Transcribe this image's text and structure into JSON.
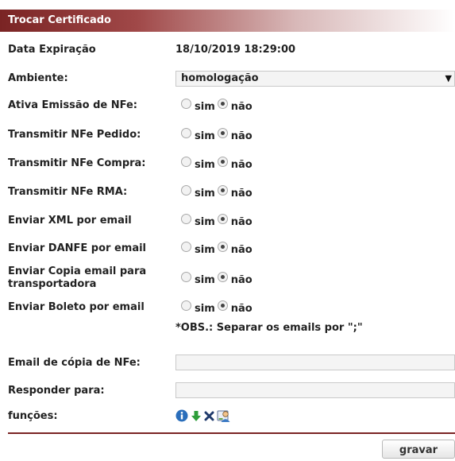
{
  "header": {
    "title": "Trocar Certificado"
  },
  "form": {
    "expiration": {
      "label": "Data Expiração",
      "value": "18/10/2019 18:29:00"
    },
    "ambiente": {
      "label": "Ambiente:",
      "selected": "homologação"
    },
    "radio_options": {
      "yes": "sim",
      "no": "não"
    },
    "settings": [
      {
        "label": "Ativa Emissão de NFe:",
        "value": "não"
      },
      {
        "label": "Transmitir NFe Pedido:",
        "value": "não"
      },
      {
        "label": "Transmitir NFe Compra:",
        "value": "não"
      },
      {
        "label": "Transmitir NFe RMA:",
        "value": "não"
      },
      {
        "label": "Enviar XML por email",
        "value": "não"
      },
      {
        "label": "Enviar DANFE por email",
        "value": "não"
      },
      {
        "label": "Enviar Copia email para transportadora",
        "value": "não"
      },
      {
        "label": "Enviar Boleto por email",
        "value": "não"
      }
    ],
    "obs": "*OBS.: Separar os emails por \";\"",
    "email_copy": {
      "label": "Email de cópia de NFe:",
      "value": ""
    },
    "reply_to": {
      "label": "Responder para:",
      "value": ""
    },
    "functions": {
      "label": "funções:",
      "icons": [
        "info-icon",
        "download-arrow-icon",
        "delete-x-icon",
        "user-certificate-icon"
      ]
    }
  },
  "actions": {
    "save_label": "gravar"
  },
  "colors": {
    "header_dark": "#7a2424",
    "info_blue": "#2a6ebb",
    "arrow_green": "#2e9e3a",
    "delete_navy": "#1f3a6b"
  }
}
